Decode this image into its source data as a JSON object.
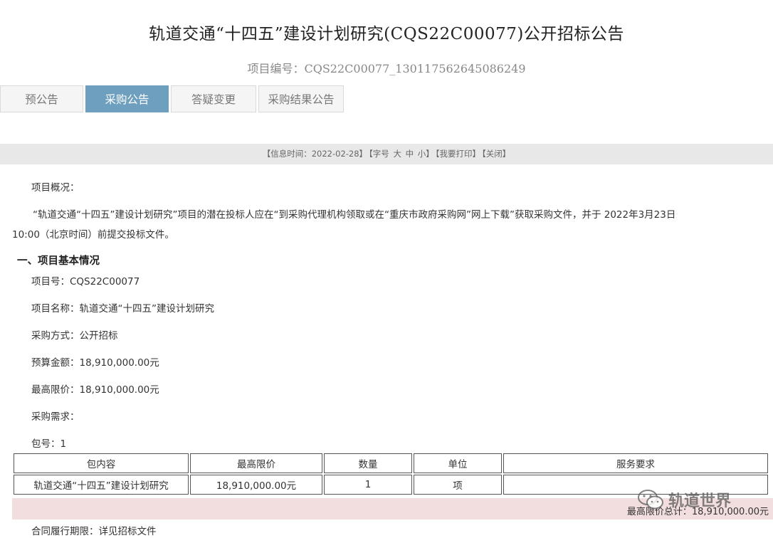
{
  "header": {
    "title": "轨道交通“十四五”建设计划研究(CQS22C00077)公开招标公告",
    "project_code": "项目编号：CQS22C00077_130117562645086249"
  },
  "tabs": [
    {
      "label": "预公告",
      "active": false
    },
    {
      "label": "采购公告",
      "active": true
    },
    {
      "label": "答疑变更",
      "active": false
    },
    {
      "label": "采购结果公告",
      "active": false
    }
  ],
  "infobar": {
    "date": "【信息时间：2022-02-28】",
    "font_prefix": "【字号",
    "font_large": "大",
    "font_medium": "中",
    "font_small": "小】",
    "print": "【我要打印】",
    "close": "【关闭】"
  },
  "content": {
    "overview_label": "项目概况：",
    "overview_line1": "“轨道交通“十四五”建设计划研究”项目的潜在投标人应在“到采购代理机构领取或在“重庆市政府采购网”网上下载”获取采购文件，并于 2022年3月23日",
    "overview_line2": "10:00（北京时间）前提交投标文件。",
    "section1_heading": "一、项目基本情况",
    "project_no": "项目号：CQS22C00077",
    "project_name": "项目名称：轨道交通“十四五”建设计划研究",
    "procurement_method": "采购方式：公开招标",
    "budget": "预算金额：18,910,000.00元",
    "max_price": "最高限价：18,910,000.00元",
    "requirements_label": "采购需求：",
    "package_no": "包号：1",
    "contract_period": "合同履行期限：详见招标文件"
  },
  "package_table": {
    "headers": [
      "包内容",
      "最高限价",
      "数量",
      "单位",
      "服务要求"
    ],
    "rows": [
      [
        "轨道交通“十四五”建设计划研究",
        "18,910,000.00元",
        "1",
        "项",
        ""
      ]
    ],
    "total_text": "最高限价总计：18,910,000.00元"
  },
  "watermark": {
    "text": "轨道世界",
    "icon": "wechat-icon"
  }
}
